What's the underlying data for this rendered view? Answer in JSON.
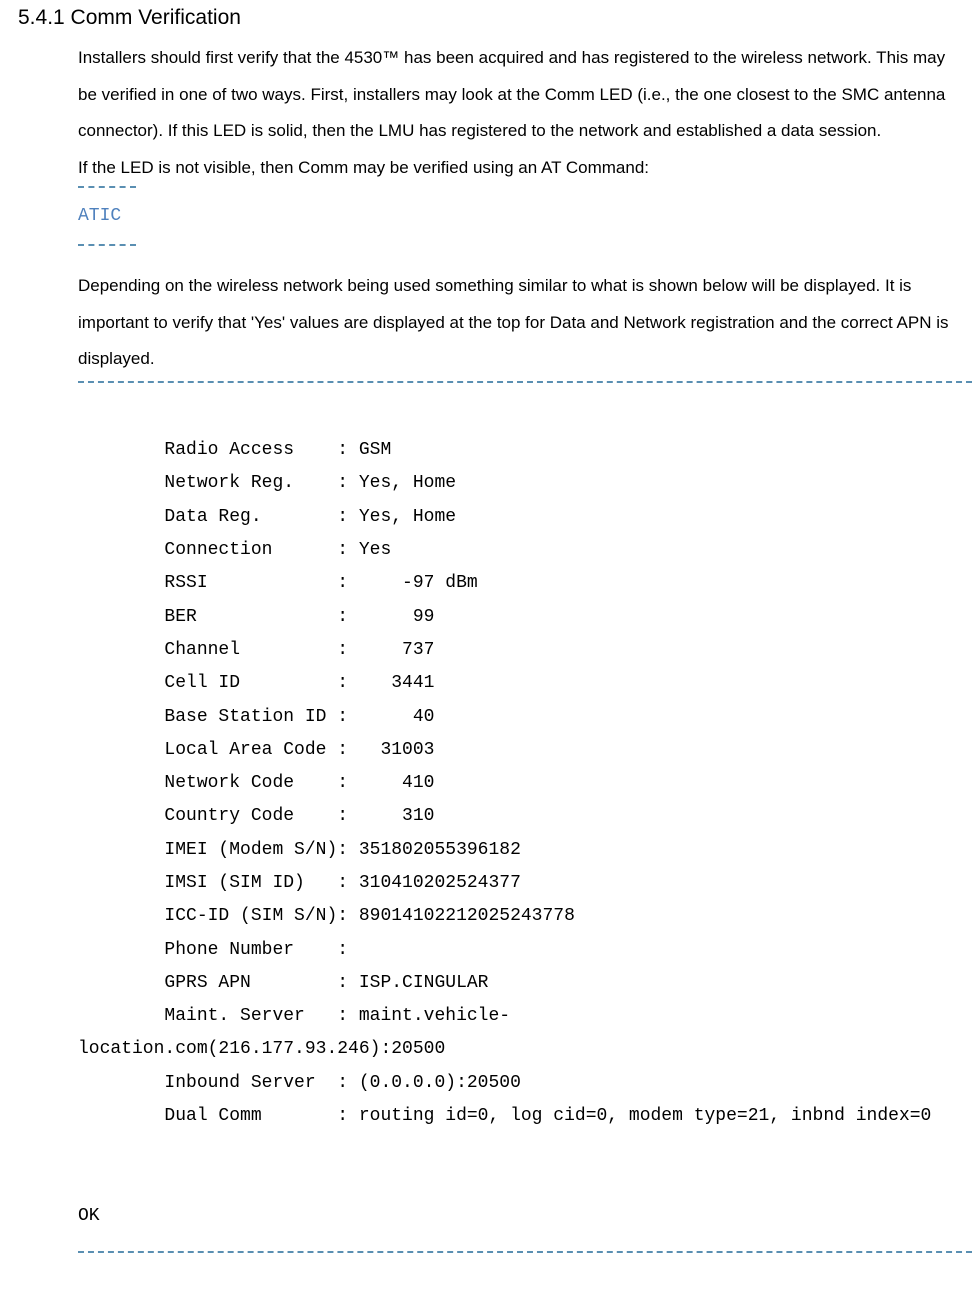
{
  "heading": "5.4.1 Comm Verification",
  "para1": "Installers should first verify that the 4530™ has been acquired and has registered to the wireless network. This may be verified in one of two ways. First, installers may look at the Comm LED (i.e., the one closest to the SMC antenna connector). If this LED is solid, then the LMU has registered to the network and established a data session.",
  "para2": "If the LED is not visible, then Comm may be verified using an AT Command:",
  "code1": "ATIC",
  "para3": "Depending on the wireless network being used something similar to what is shown below will be displayed. It is important to verify that 'Yes' values are displayed at the top for Data and Network registration and the correct APN is displayed.",
  "code2": "\n        Radio Access    : GSM\n        Network Reg.    : Yes, Home\n        Data Reg.       : Yes, Home\n        Connection      : Yes\n        RSSI            :     -97 dBm\n        BER             :      99\n        Channel         :     737\n        Cell ID         :    3441\n        Base Station ID :      40\n        Local Area Code :   31003\n        Network Code    :     410\n        Country Code    :     310\n        IMEI (Modem S/N): 351802055396182\n        IMSI (SIM ID)   : 310410202524377\n        ICC-ID (SIM S/N): 89014102212025243778\n        Phone Number    :\n        GPRS APN        : ISP.CINGULAR\n        Maint. Server   : maint.vehicle-\nlocation.com(216.177.93.246):20500\n        Inbound Server  : (0.0.0.0):20500\n        Dual Comm       : routing id=0, log cid=0, modem type=21, inbnd index=0\n\n\nOK"
}
